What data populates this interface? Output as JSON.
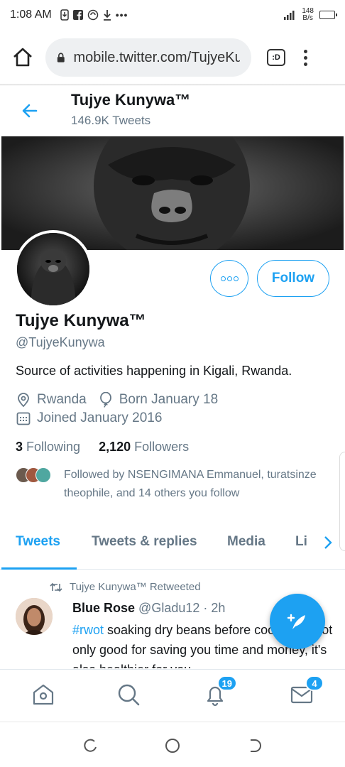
{
  "status_bar": {
    "time": "1:08 AM",
    "notif_icons": [
      "download-icon",
      "facebook-icon",
      "vpn-icon",
      "download-arrow-icon"
    ],
    "more": "•••",
    "net_speed_value": "148",
    "net_speed_unit": "B/s"
  },
  "browser": {
    "url": "mobile.twitter.com/TujyeKunywa",
    "tabs_label": ":D"
  },
  "profile": {
    "header_name": "Tujye Kunywa™",
    "tweet_count": "146.9K Tweets",
    "display_name": "Tujye Kunywa™",
    "handle": "@TujyeKunywa",
    "bio": "Source of activities happening in Kigali, Rwanda.",
    "location": "Rwanda",
    "birthday": "Born January 18",
    "joined": "Joined January 2016",
    "following_count": "3",
    "following_label": "Following",
    "followers_count": "2,120",
    "followers_label": "Followers",
    "followed_by": "Followed by NSENGIMANA Emmanuel, turatsinze theophile, and 14 others you follow",
    "follow_button": "Follow"
  },
  "tabs": [
    {
      "label": "Tweets",
      "active": true
    },
    {
      "label": "Tweets & replies",
      "active": false
    },
    {
      "label": "Media",
      "active": false
    },
    {
      "label": "Li",
      "active": false
    }
  ],
  "tweet": {
    "retweeted_by": "Tujye Kunywa™ Retweeted",
    "author_name": "Blue Rose",
    "author_handle": "@Gladu12",
    "time": "· 2h",
    "hashtag": "#rwot",
    "text": " soaking dry beans before cooking is not only good for saving you time and money, it's also healthier for you"
  },
  "bottom_nav": {
    "notifications_badge": "19",
    "messages_badge": "4"
  },
  "colors": {
    "accent": "#1da1f2",
    "muted": "#657786",
    "text": "#14171a"
  }
}
